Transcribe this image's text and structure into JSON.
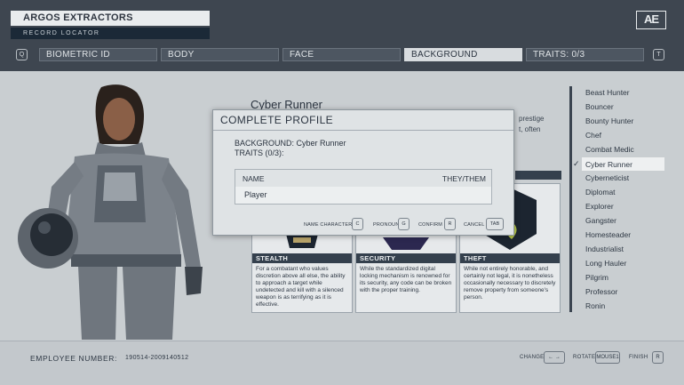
{
  "header": {
    "company": "ARGOS EXTRACTORS",
    "record_locator": "RECORD LOCATOR",
    "logo": "AE",
    "left_key": "Q",
    "right_key": "T"
  },
  "tabs": [
    {
      "label": "BIOMETRIC ID"
    },
    {
      "label": "BODY"
    },
    {
      "label": "FACE"
    },
    {
      "label": "BACKGROUND"
    },
    {
      "label": "TRAITS: 0/3"
    }
  ],
  "background": {
    "title": "Cyber Runner",
    "desc_peek_1": "prestige",
    "desc_peek_2": "t, often"
  },
  "skills": [
    {
      "name": "STEALTH",
      "desc": "For a combatant who values discretion above all else, the ability to approach a target while undetected and kill with a silenced weapon is as terrifying as it is effective."
    },
    {
      "name": "SECURITY",
      "desc": "While the standardized digital locking mechanism is renowned for its security, any code can be broken with the proper training."
    },
    {
      "name": "THEFT",
      "desc": "While not entirely honorable, and certainly not legal, it is nonetheless occasionally necessary to discretely remove property from someone's person."
    }
  ],
  "backgrounds_list": [
    {
      "label": "Beast Hunter"
    },
    {
      "label": "Bouncer"
    },
    {
      "label": "Bounty Hunter"
    },
    {
      "label": "Chef"
    },
    {
      "label": "Combat Medic"
    },
    {
      "label": "Cyber Runner"
    },
    {
      "label": "Cyberneticist"
    },
    {
      "label": "Diplomat"
    },
    {
      "label": "Explorer"
    },
    {
      "label": "Gangster"
    },
    {
      "label": "Homesteader"
    },
    {
      "label": "Industrialist"
    },
    {
      "label": "Long Hauler"
    },
    {
      "label": "Pilgrim"
    },
    {
      "label": "Professor"
    },
    {
      "label": "Ronin"
    }
  ],
  "selected_check": "✓",
  "dialog": {
    "title": "COMPLETE PROFILE",
    "background_line": "BACKGROUND: Cyber Runner",
    "traits_line": "TRAITS (0/3):",
    "name_header": "NAME",
    "pronoun_header": "THEY/THEM",
    "player_name": "Player",
    "hints": [
      {
        "label": "NAME CHARACTER",
        "key": "C"
      },
      {
        "label": "PRONOUN",
        "key": "G"
      },
      {
        "label": "CONFIRM",
        "key": "R"
      },
      {
        "label": "CANCEL",
        "key": "TAB"
      }
    ]
  },
  "footer": {
    "employee_label": "EMPLOYEE NUMBER:",
    "employee_number": "190514-2009140512",
    "change_label": "CHANGE",
    "change_key": "← →",
    "rotate_label": "ROTATE",
    "rotate_key": "MOUSE1",
    "finish_label": "FINISH",
    "finish_key": "R"
  },
  "colors": {
    "top_bar": "#3e4650",
    "panel_bg": "#c9ced1",
    "card_header": "#34404d",
    "card_art_dark": "#1c2530",
    "theft_icon": "#b9c94a"
  }
}
